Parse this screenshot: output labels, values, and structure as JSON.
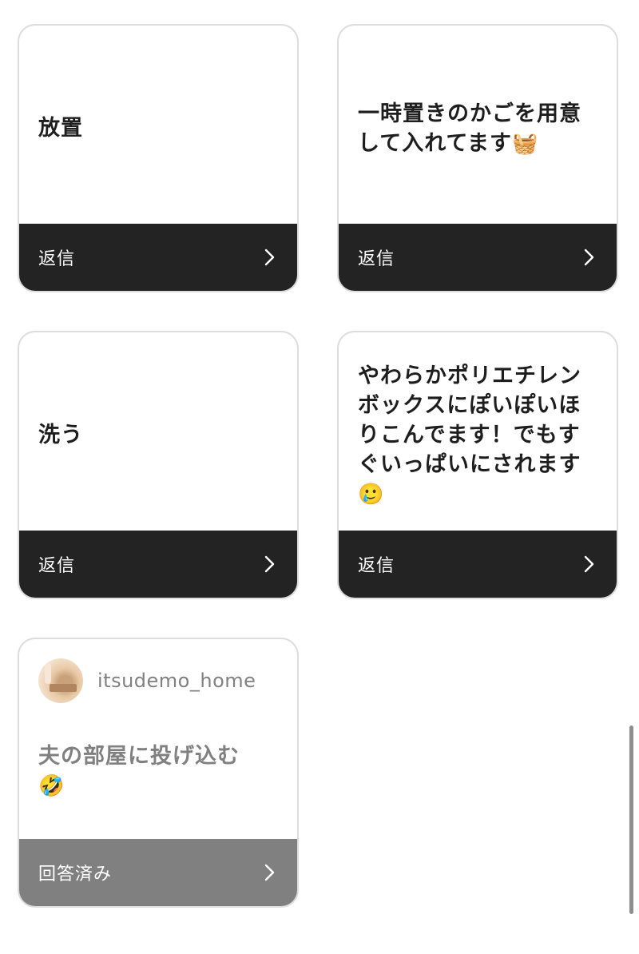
{
  "cards": [
    {
      "text": "放置",
      "emoji": "",
      "footer": "返信"
    },
    {
      "text": "一時置きのかごを用意して入れてます",
      "emoji": "🧺",
      "footer": "返信"
    },
    {
      "text": "洗う",
      "emoji": "",
      "footer": "返信"
    },
    {
      "text": "やわらかポリエチレンボックスにぽいぽいほりこんでます！でもすぐいっぱいにされます",
      "emoji": "🥲",
      "footer": "返信"
    }
  ],
  "answered_card": {
    "username": "itsudemo_home",
    "text": "夫の部屋に投げ込む",
    "emoji": "🤣",
    "footer": "回答済み"
  },
  "icons": {
    "chevron": "chevron-right-icon",
    "avatar": "avatar"
  },
  "colors": {
    "footer_dark": "#232323",
    "footer_answered": "#808080",
    "card_border": "#dcdcdc",
    "muted_text": "#808080"
  }
}
